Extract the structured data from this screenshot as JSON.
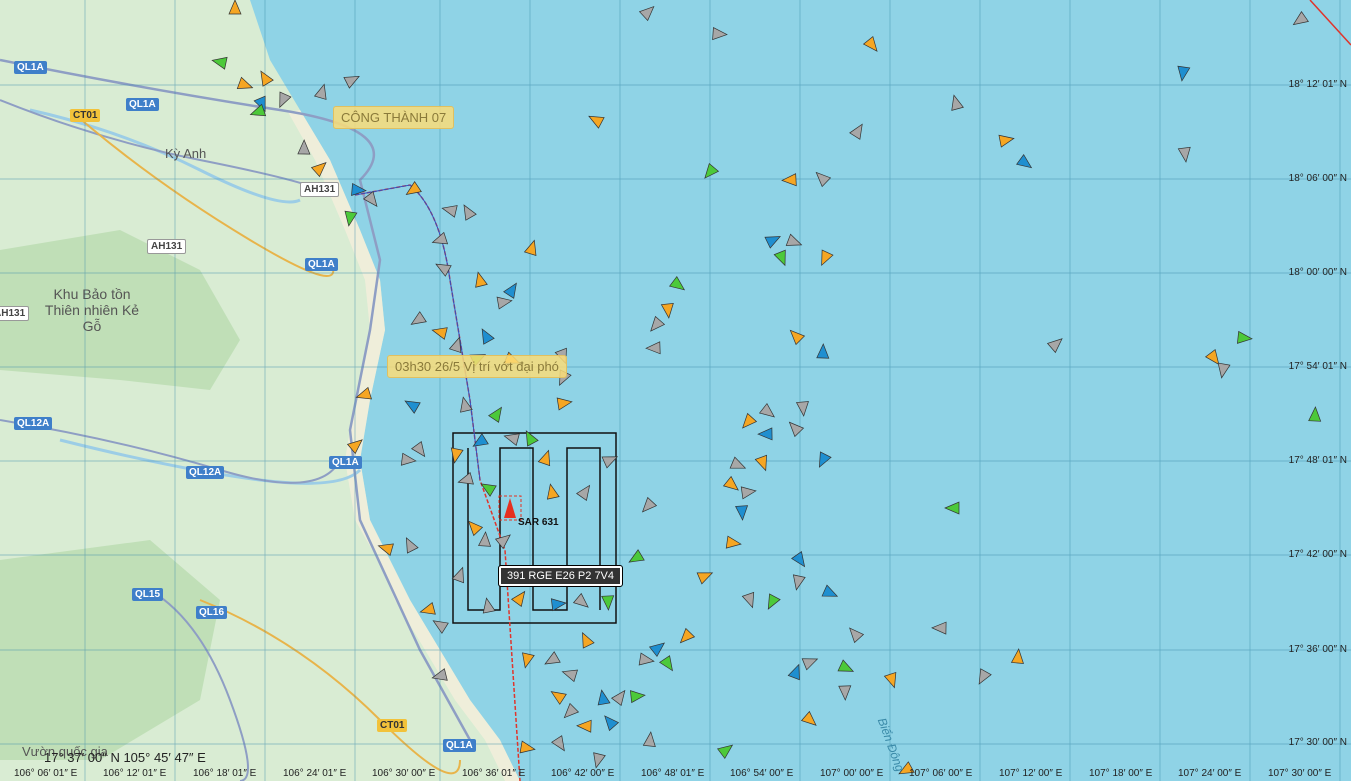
{
  "map": {
    "coordinate_readout": "17° 37′ 00″ N 105° 45′ 47″ E",
    "places": {
      "ky_anh": "Kỳ Anh",
      "khu_bao_ton": "Khu Bảo tồn Thiên nhiên Kẻ Gỗ",
      "vuon_quoc_gia": "Vườn quốc gia",
      "bien_dong": "Biển Đông"
    },
    "roads": [
      "QL1A",
      "QL1A",
      "CT01",
      "AH131",
      "AH131",
      "QL1A",
      "AH131",
      "QL12A",
      "QL12A",
      "QL1A",
      "QL15",
      "QL16",
      "CT01",
      "QL1A"
    ],
    "latitude_labels": [
      "18° 12′ 01″ N",
      "18° 06′ 00″ N",
      "18° 00′ 00″ N",
      "17° 54′ 01″ N",
      "17° 48′ 01″ N",
      "17° 42′ 00″ N",
      "17° 36′ 00″ N",
      "17° 30′ 00″ N"
    ],
    "longitude_labels": [
      "106° 06′ 01″ E",
      "106° 12′ 01″ E",
      "106° 18′ 01″ E",
      "106° 24′ 01″ E",
      "106° 30′ 00″ E",
      "106° 36′ 01″ E",
      "106° 42′ 00″ E",
      "106° 48′ 01″ E",
      "106° 54′ 00″ E",
      "107° 00′ 00″ E",
      "107° 06′ 00″ E",
      "107° 12′ 00″ E",
      "107° 18′ 00″ E",
      "107° 24′ 00″ E",
      "107° 30′ 00″ E"
    ],
    "callouts": {
      "cong_thanh": "CÔNG THÀNH 07",
      "vi_tri": "03h30 26/5 Vị trí vớt đại phó"
    },
    "vessel_tag": "391 RGE E26 P2 7V4",
    "sar_label": "SAR 631",
    "colors": {
      "sea": "#8fd3e6",
      "land": "#d9ecd3",
      "vessel_orange": "#f5a623",
      "vessel_gray": "#a7a7a7",
      "vessel_blue": "#1f8fd0",
      "vessel_green": "#4cc93a",
      "track": "#e0342b"
    }
  }
}
